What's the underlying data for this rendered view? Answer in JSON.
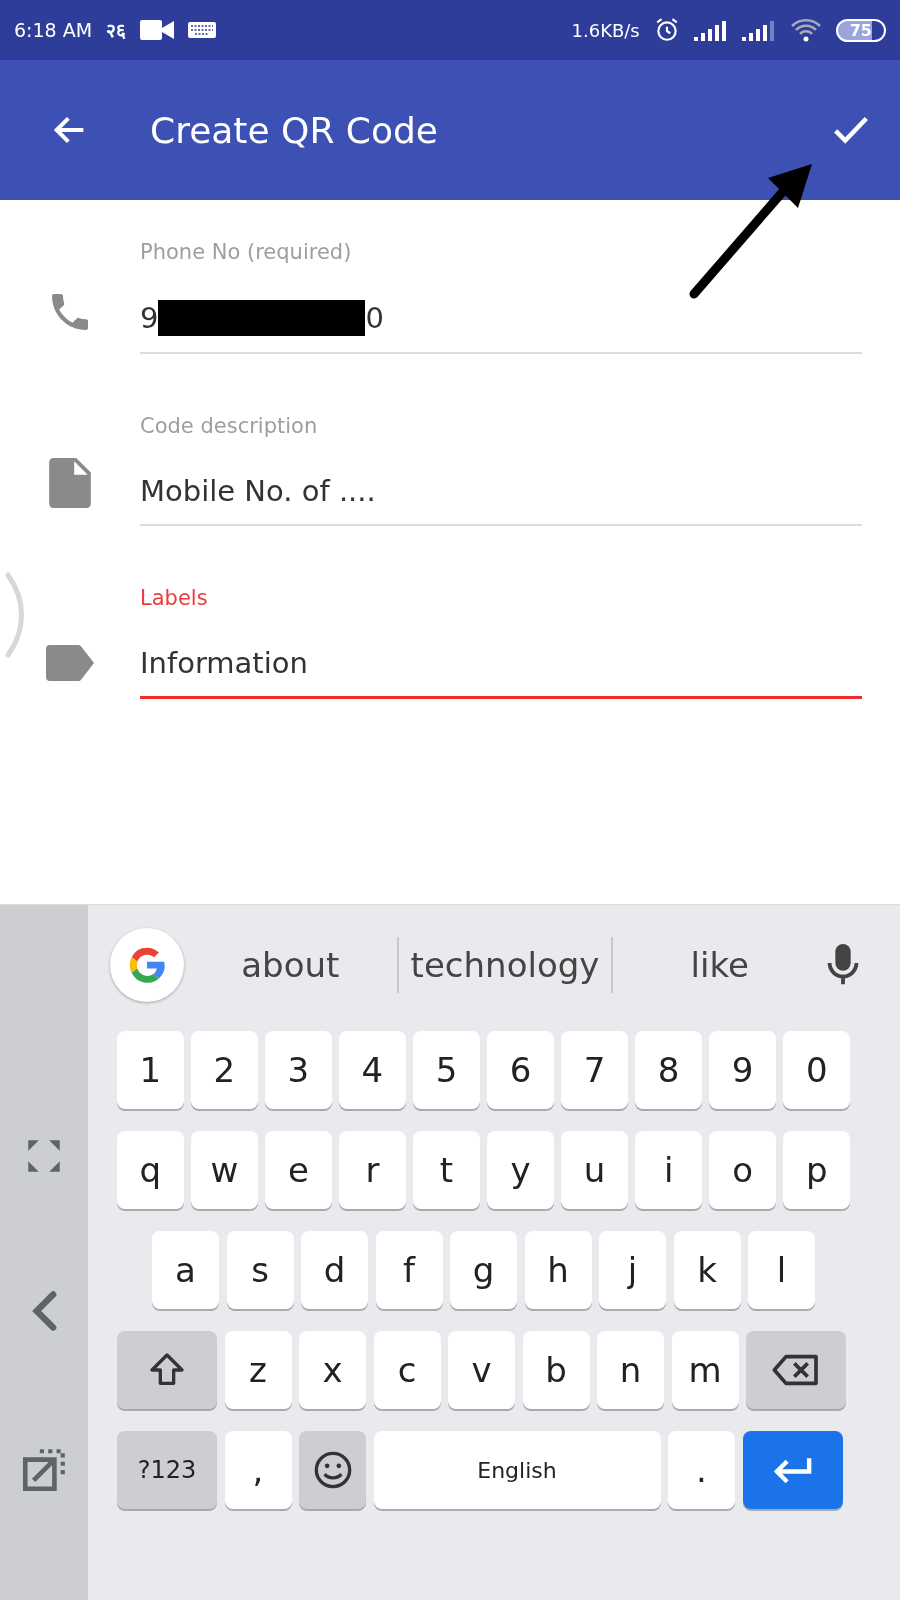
{
  "status_bar": {
    "time": "6:18 AM",
    "date_badge": "२६",
    "network_speed": "1.6KB/s",
    "battery": "75"
  },
  "app_bar": {
    "title": "Create QR Code"
  },
  "fields": [
    {
      "kind": "phone",
      "label": "Phone No (required)",
      "value_start": "9",
      "redacted": true,
      "value_end": "0",
      "focused": false
    },
    {
      "kind": "description",
      "label": "Code description",
      "value_start": "Mobile No. of ....",
      "redacted": false,
      "focused": false
    },
    {
      "kind": "label",
      "label": "Labels",
      "value_start": "Information",
      "redacted": false,
      "focused": true
    }
  ],
  "keyboard": {
    "suggestions": [
      "about",
      "technology",
      "like"
    ],
    "rows": [
      [
        {
          "kind": "char",
          "label": "1"
        },
        {
          "kind": "char",
          "label": "2"
        },
        {
          "kind": "char",
          "label": "3"
        },
        {
          "kind": "char",
          "label": "4"
        },
        {
          "kind": "char",
          "label": "5"
        },
        {
          "kind": "char",
          "label": "6"
        },
        {
          "kind": "char",
          "label": "7"
        },
        {
          "kind": "char",
          "label": "8"
        },
        {
          "kind": "char",
          "label": "9"
        },
        {
          "kind": "char",
          "label": "0"
        }
      ],
      [
        {
          "kind": "char",
          "label": "q"
        },
        {
          "kind": "char",
          "label": "w"
        },
        {
          "kind": "char",
          "label": "e"
        },
        {
          "kind": "char",
          "label": "r"
        },
        {
          "kind": "char",
          "label": "t"
        },
        {
          "kind": "char",
          "label": "y"
        },
        {
          "kind": "char",
          "label": "u"
        },
        {
          "kind": "char",
          "label": "i"
        },
        {
          "kind": "char",
          "label": "o"
        },
        {
          "kind": "char",
          "label": "p"
        }
      ],
      [
        {
          "kind": "char",
          "label": "a"
        },
        {
          "kind": "char",
          "label": "s"
        },
        {
          "kind": "char",
          "label": "d"
        },
        {
          "kind": "char",
          "label": "f"
        },
        {
          "kind": "char",
          "label": "g"
        },
        {
          "kind": "char",
          "label": "h"
        },
        {
          "kind": "char",
          "label": "j"
        },
        {
          "kind": "char",
          "label": "k"
        },
        {
          "kind": "char",
          "label": "l"
        }
      ],
      [
        {
          "kind": "shift"
        },
        {
          "kind": "char",
          "label": "z"
        },
        {
          "kind": "char",
          "label": "x"
        },
        {
          "kind": "char",
          "label": "c"
        },
        {
          "kind": "char",
          "label": "v"
        },
        {
          "kind": "char",
          "label": "b"
        },
        {
          "kind": "char",
          "label": "n"
        },
        {
          "kind": "char",
          "label": "m"
        },
        {
          "kind": "backspace"
        }
      ],
      [
        {
          "kind": "symbols",
          "label": "?123"
        },
        {
          "kind": "char",
          "label": ","
        },
        {
          "kind": "emoji"
        },
        {
          "kind": "space",
          "label": "English"
        },
        {
          "kind": "char",
          "label": "."
        },
        {
          "kind": "enter"
        }
      ]
    ]
  }
}
